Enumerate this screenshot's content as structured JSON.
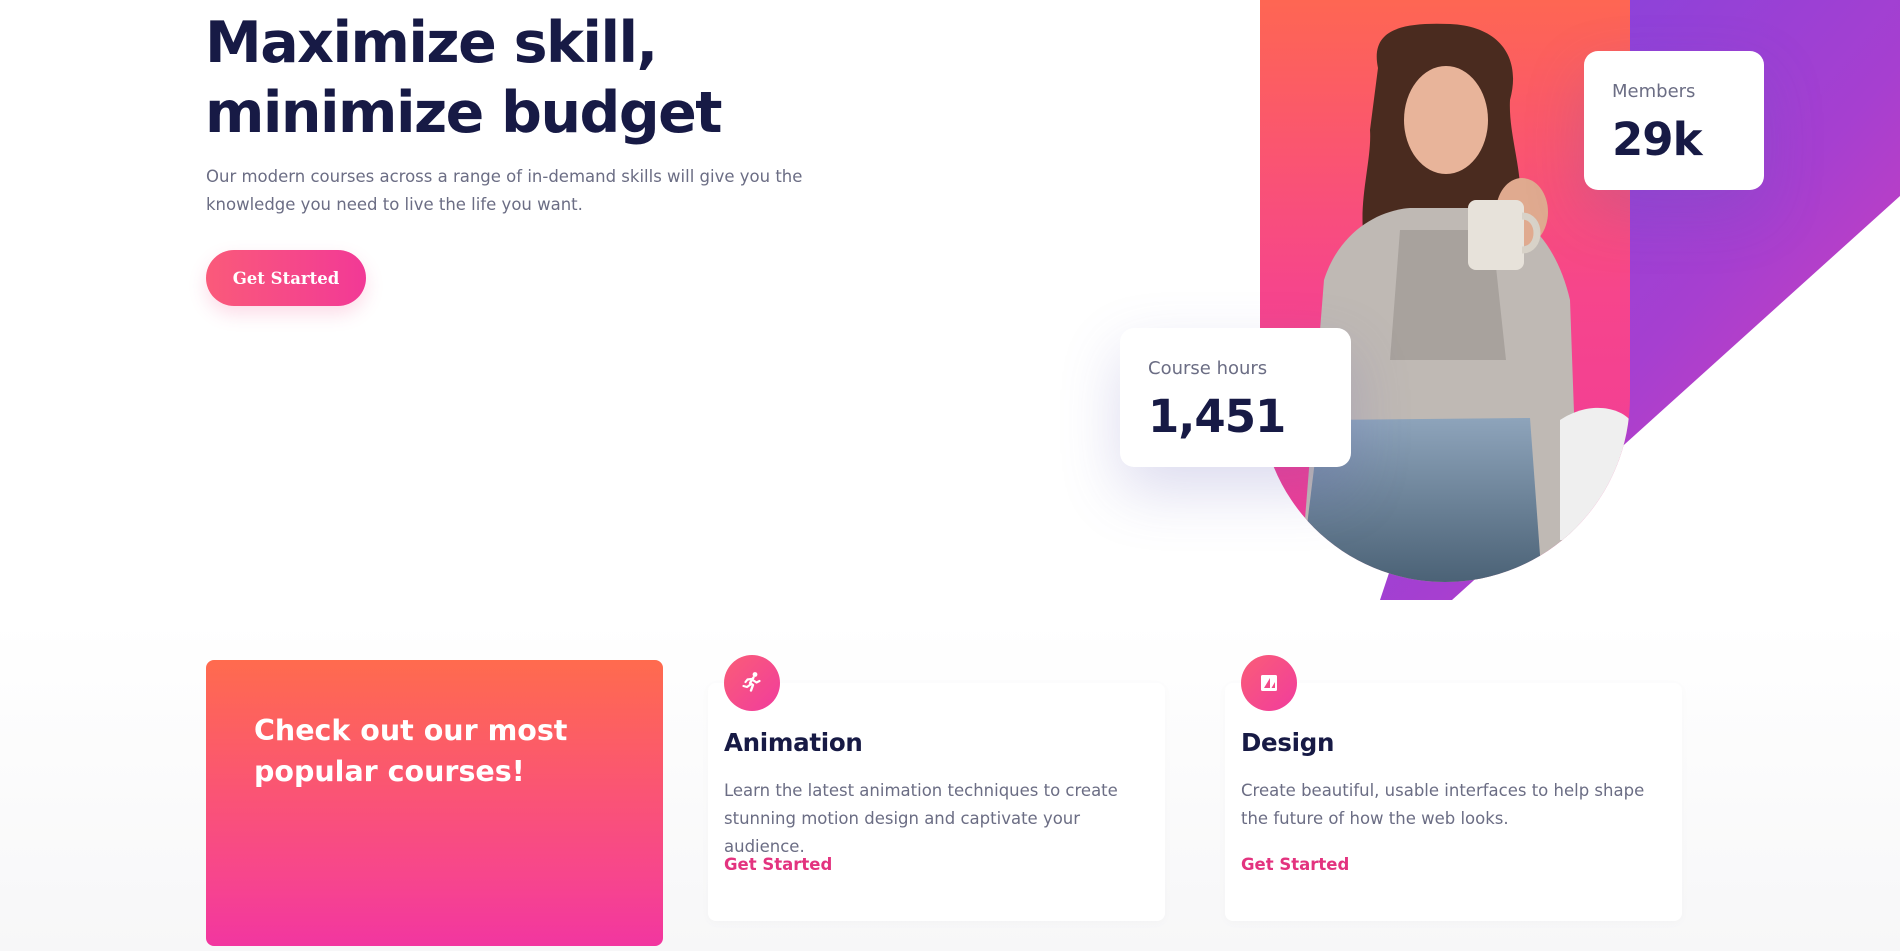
{
  "hero": {
    "title": "Maximize skill, minimize budget",
    "description": "Our modern courses across a range of in-demand skills will give you the knowledge you need to live the life you want.",
    "cta_label": "Get Started"
  },
  "stats": {
    "members": {
      "label": "Members",
      "value": "29k"
    },
    "hours": {
      "label": "Course hours",
      "value": "1,451"
    }
  },
  "promo": {
    "title": "Check out our most popular courses!"
  },
  "courses": [
    {
      "title": "Animation",
      "description": "Learn the latest animation techniques to create stunning motion design and captivate your audience.",
      "link_label": "Get Started",
      "icon": "running-figure-icon"
    },
    {
      "title": "Design",
      "description": "Create beautiful, usable interfaces to help shape the future of how the web looks.",
      "link_label": "Get Started",
      "icon": "design-tool-icon"
    }
  ],
  "colors": {
    "heading": "#171a45",
    "body_text": "#6b6d84",
    "accent_pink": "#f23996",
    "accent_coral": "#ff6b4e",
    "accent_purple": "#7b44e0",
    "link": "#e3337f"
  }
}
